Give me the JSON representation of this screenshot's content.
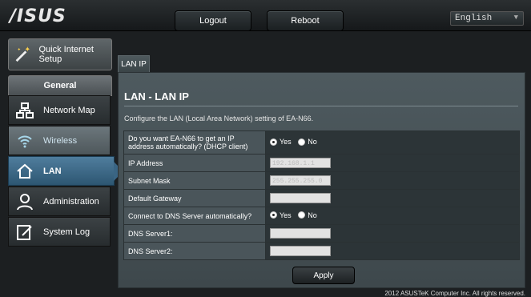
{
  "topbar": {
    "logo": "/ISUS",
    "logout": "Logout",
    "reboot": "Reboot",
    "language": "English"
  },
  "sidebar": {
    "quick_setup": "Quick Internet Setup",
    "section": "General",
    "items": [
      {
        "label": "Network Map",
        "icon": "network-map-icon"
      },
      {
        "label": "Wireless",
        "icon": "wireless-icon"
      },
      {
        "label": "LAN",
        "icon": "home-icon"
      },
      {
        "label": "Administration",
        "icon": "admin-user-icon"
      },
      {
        "label": "System Log",
        "icon": "system-log-icon"
      }
    ]
  },
  "tab": "LAN IP",
  "panel": {
    "title": "LAN - LAN IP",
    "description": "Configure the LAN (Local Area Network) setting of EA-N66.",
    "dhcp_question": "Do you want EA-N66 to get an IP address automatically? (DHCP client)",
    "ip_label": "IP Address",
    "ip_value": "192.168.1.1",
    "mask_label": "Subnet Mask",
    "mask_value": "255.255.255.0",
    "gateway_label": "Default Gateway",
    "gateway_value": "",
    "dns_auto_label": "Connect to DNS Server automatically?",
    "dns1_label": "DNS Server1:",
    "dns2_label": "DNS Server2:",
    "yes": "Yes",
    "no": "No",
    "apply": "Apply"
  },
  "footer": "2012 ASUSTeK Computer Inc. All rights reserved.",
  "colors": {
    "active_menu": "#3a6584",
    "panel": "#4e5a5f"
  }
}
